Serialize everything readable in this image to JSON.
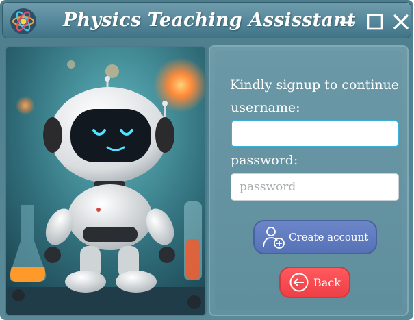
{
  "window": {
    "title": "Physics Teaching Assisstant",
    "app_icon": "atom-icon",
    "controls": {
      "minimize": "minimize-icon",
      "maximize": "maximize-icon",
      "close": "close-icon"
    }
  },
  "illustration": {
    "subject": "robot-illustration"
  },
  "form": {
    "prompt": "Kindly signup to continue",
    "username_label": "username:",
    "username_value": "",
    "password_label": "password:",
    "password_placeholder": "password",
    "create_button": {
      "label": "Create account",
      "icon": "add-user-icon"
    },
    "back_button": {
      "label": "Back",
      "icon": "arrow-left-circle-icon"
    }
  },
  "colors": {
    "window_bg": "#5a8a98",
    "create_button": "#5a74b8",
    "back_button": "#f24a4f",
    "input_focus_border": "#3ab0d6"
  }
}
